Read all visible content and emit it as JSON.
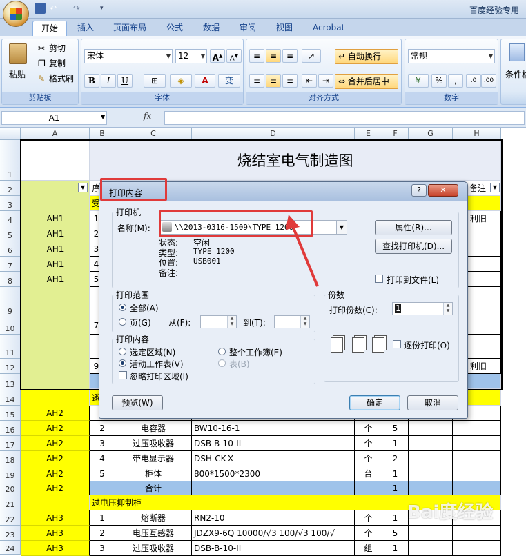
{
  "app": {
    "title": "百度经验专用"
  },
  "tabs": [
    "开始",
    "插入",
    "页面布局",
    "公式",
    "数据",
    "审阅",
    "视图",
    "Acrobat"
  ],
  "ribbon": {
    "clipboard": {
      "paste": "粘贴",
      "cut": "剪切",
      "copy": "复制",
      "format_painter": "格式刷",
      "label": "剪贴板"
    },
    "font": {
      "name": "宋体",
      "size": "12",
      "bold": "B",
      "italic": "I",
      "underline": "U",
      "phonetic": "变",
      "label": "字体"
    },
    "alignment": {
      "wrap": "自动换行",
      "merge": "合并后居中",
      "label": "对齐方式"
    },
    "number": {
      "format": "常规",
      "percent": "%",
      "comma": ",",
      "label": "数字"
    },
    "styles": {
      "cond": "条件格"
    }
  },
  "formula_bar": {
    "name_box": "A1",
    "fx": "fx"
  },
  "columns": [
    "A",
    "B",
    "C",
    "D",
    "E",
    "F",
    "G",
    "H"
  ],
  "rows": [
    "1",
    "2",
    "3",
    "4",
    "5",
    "6",
    "7",
    "8",
    "9",
    "10",
    "11",
    "12",
    "13",
    "14",
    "15",
    "16",
    "17",
    "18",
    "19",
    "20",
    "21",
    "22",
    "23",
    "24"
  ],
  "sheet": {
    "title": "烧结室电气制造图",
    "header_b": "序",
    "header_h": "备注",
    "r3": "受",
    "r14": "避雷",
    "r21": "过电压抑制柜",
    "a_ah1": [
      "AH1",
      "AH1",
      "AH1",
      "AH1",
      "AH1"
    ],
    "b_vals_top": [
      "1",
      "2",
      "3",
      "4",
      "5",
      "7",
      "9"
    ],
    "h4": "利旧",
    "h12": "利旧",
    "rows_lower": [
      {
        "a": "AH2",
        "b": "1",
        "c": "",
        "d": "",
        "e": "",
        "f": ""
      },
      {
        "a": "AH2",
        "b": "2",
        "c": "电容器",
        "d": "BW10-16-1",
        "e": "个",
        "f": "5"
      },
      {
        "a": "AH2",
        "b": "3",
        "c": "过压吸收器",
        "d": "DSB-B-10-II",
        "e": "个",
        "f": "1"
      },
      {
        "a": "AH2",
        "b": "4",
        "c": "带电显示器",
        "d": "DSH-CK-X",
        "e": "个",
        "f": "2"
      },
      {
        "a": "AH2",
        "b": "5",
        "c": "柜体",
        "d": "800*1500*2300",
        "e": "台",
        "f": "1"
      },
      {
        "a": "AH2",
        "b": "",
        "c": "合计",
        "d": "",
        "e": "",
        "f": "1"
      }
    ],
    "rows_ah3": [
      {
        "a": "AH3",
        "b": "1",
        "c": "熔断器",
        "d": "RN2-10",
        "e": "个",
        "f": "1"
      },
      {
        "a": "AH3",
        "b": "2",
        "c": "电压互感器",
        "d": "JDZX9-6Q 10000/√3 100/√3 100/√",
        "e": "个",
        "f": "5"
      },
      {
        "a": "AH3",
        "b": "3",
        "c": "过压吸收器",
        "d": "DSB-B-10-II",
        "e": "组",
        "f": "1"
      }
    ]
  },
  "dialog": {
    "title": "打印内容",
    "help": "?",
    "close": "✕",
    "printer_group": "打印机",
    "name_label": "名称(M):",
    "printer_name": "\\\\2013-0316-1509\\TYPE 1200",
    "status_label": "状态:",
    "status_val": "空闲",
    "type_label": "类型:",
    "type_val": "TYPE 1200",
    "where_label": "位置:",
    "where_val": "USB001",
    "comment_label": "备注:",
    "properties": "属性(R)...",
    "find_printer": "查找打印机(D)...",
    "print_to_file": "打印到文件(L)",
    "range_group": "打印范围",
    "all": "全部(A)",
    "pages": "页(G)",
    "from": "从(F):",
    "to": "到(T):",
    "copies_group": "份数",
    "copies_label": "打印份数(C):",
    "copies_val": "1",
    "collate": "逐份打印(O)",
    "what_group": "打印内容",
    "selection": "选定区域(N)",
    "entire_workbook": "整个工作簿(E)",
    "active_sheets": "活动工作表(V)",
    "table": "表(B)",
    "ignore_area": "忽略打印区域(I)",
    "preview": "预览(W)",
    "ok": "确定",
    "cancel": "取消"
  },
  "watermark": "Bai度经验",
  "colors": {
    "accent_red": "#e03a3a",
    "yellow": "#ffff00",
    "lime": "#e2ef92",
    "blue_row": "#9fc3ea",
    "ribbon_blue": "#15428b"
  }
}
